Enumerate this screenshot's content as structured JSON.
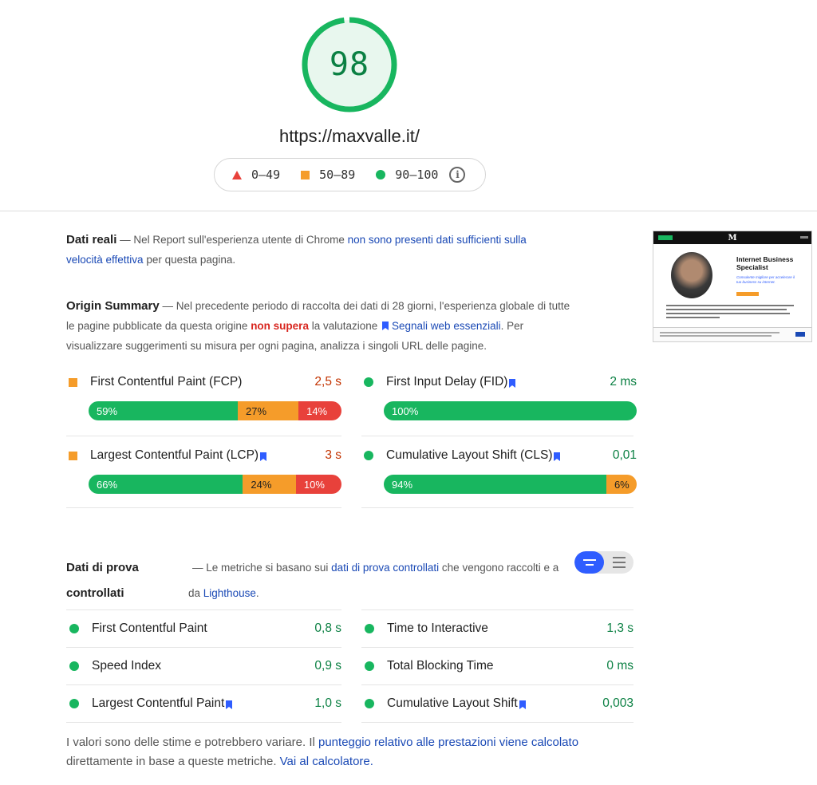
{
  "header": {
    "score": "98",
    "url": "https://maxvalle.it/",
    "legend": {
      "fail": "0–49",
      "average": "50–89",
      "pass": "90–100"
    },
    "score_fraction": 0.98,
    "colors": {
      "pass": "#18b65f",
      "average": "#f59c2a",
      "fail": "#e8413b",
      "link": "#1a49b5"
    }
  },
  "field": {
    "title": "Dati reali",
    "text_before": " — Nel Report sull'esperienza utente di Chrome ",
    "link": "non sono presenti dati sufficienti sulla velocità effettiva",
    "text_after": " per questa pagina."
  },
  "origin": {
    "title": "Origin Summary",
    "text_1": " — Nel precedente periodo di raccolta dei dati di 28 giorni, l'esperienza globale di tutte le pagine pubblicate da questa origine ",
    "fail_word": "non supera",
    "text_2": " la valutazione ",
    "link": "Segnali web essenziali",
    "text_3": ". Per visualizzare suggerimenti su misura per ogni pagina, analizza i singoli URL delle pagine.",
    "metrics": [
      {
        "name": "First Contentful Paint (FCP)",
        "value": "2,5 s",
        "good": "59%",
        "avg": "27%",
        "poor": "14%"
      },
      {
        "name": "First Input Delay (FID)",
        "value": "2 ms",
        "good": "100%"
      },
      {
        "name": "Largest Contentful Paint (LCP)",
        "value": "3 s",
        "good": "66%",
        "avg": "24%",
        "poor": "10%"
      },
      {
        "name": "Cumulative Layout Shift (CLS)",
        "value": "0,01",
        "good": "94%",
        "avg": "6%"
      }
    ]
  },
  "lab": {
    "title_1": "Dati di prova",
    "title_2": "controllati",
    "text_1": "— Le metriche si basano sui ",
    "link": "dati di prova controllati",
    "text_2": " che vengono raccolti e a",
    "text_3": "da ",
    "link2": "Lighthouse",
    "text_4": ".",
    "metrics": [
      {
        "name": "First Contentful Paint",
        "value": "0,8 s"
      },
      {
        "name": "Time to Interactive",
        "value": "1,3 s"
      },
      {
        "name": "Speed Index",
        "value": "0,9 s"
      },
      {
        "name": "Total Blocking Time",
        "value": "0 ms"
      },
      {
        "name": "Largest Contentful Paint",
        "value": "1,0 s"
      },
      {
        "name": "Cumulative Layout Shift",
        "value": "0,003"
      }
    ]
  },
  "footer": {
    "text_1": "I valori sono delle stime e potrebbero variare. Il ",
    "link": "punteggio relativo alle prestazioni viene calcolato",
    "text_2": " direttamente in base a queste metriche. ",
    "link2": "Vai al calcolatore."
  },
  "thumbnail": {
    "headline": "Internet Business Specialist",
    "sub": "Consulente migliore per accelerare il tuo business su internet."
  }
}
